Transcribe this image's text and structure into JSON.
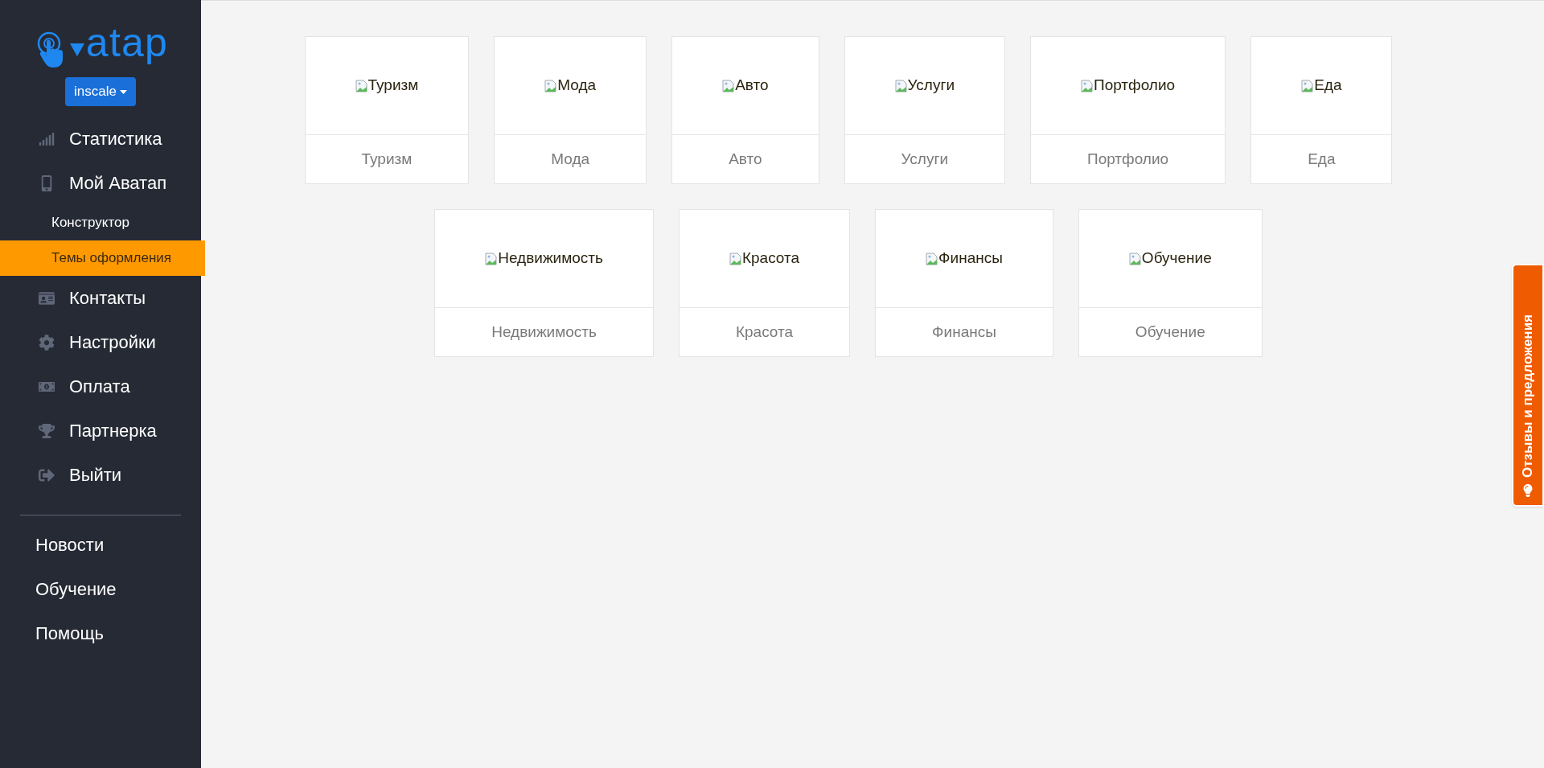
{
  "sidebar": {
    "logo": {
      "text": "atap"
    },
    "account_button": {
      "label": "inscale"
    },
    "menu": [
      {
        "kind": "main",
        "label": "Статистика",
        "selected": false
      },
      {
        "kind": "main",
        "label": "Мой Аватап",
        "selected": false
      },
      {
        "kind": "sub",
        "label": "Конструктор",
        "selected": false
      },
      {
        "kind": "sub",
        "label": "Темы оформления",
        "selected": true
      },
      {
        "kind": "main",
        "label": "Контакты",
        "selected": false
      },
      {
        "kind": "main",
        "label": "Настройки",
        "selected": false
      },
      {
        "kind": "main",
        "label": "Оплата",
        "selected": false
      },
      {
        "kind": "main",
        "label": "Партнерка",
        "selected": false
      },
      {
        "kind": "main",
        "label": "Выйти",
        "selected": false
      }
    ],
    "links": [
      {
        "label": "Новости"
      },
      {
        "label": "Обучение"
      },
      {
        "label": "Помощь"
      }
    ]
  },
  "themes": [
    [
      {
        "alt": "Туризм",
        "label": "Туризм"
      },
      {
        "alt": "Мода",
        "label": "Мода"
      },
      {
        "alt": "Авто",
        "label": "Авто"
      },
      {
        "alt": "Услуги",
        "label": "Услуги"
      },
      {
        "alt": "Портфолио",
        "label": "Портфолио"
      },
      {
        "alt": "Еда",
        "label": "Еда"
      }
    ],
    [
      {
        "alt": "Недвижимость",
        "label": "Недвижимость"
      },
      {
        "alt": "Красота",
        "label": "Красота"
      },
      {
        "alt": "Финансы",
        "label": "Финансы"
      },
      {
        "alt": "Обучение",
        "label": "Обучение"
      }
    ]
  ],
  "feedback_tab": {
    "label": "Отзывы и предложения"
  }
}
